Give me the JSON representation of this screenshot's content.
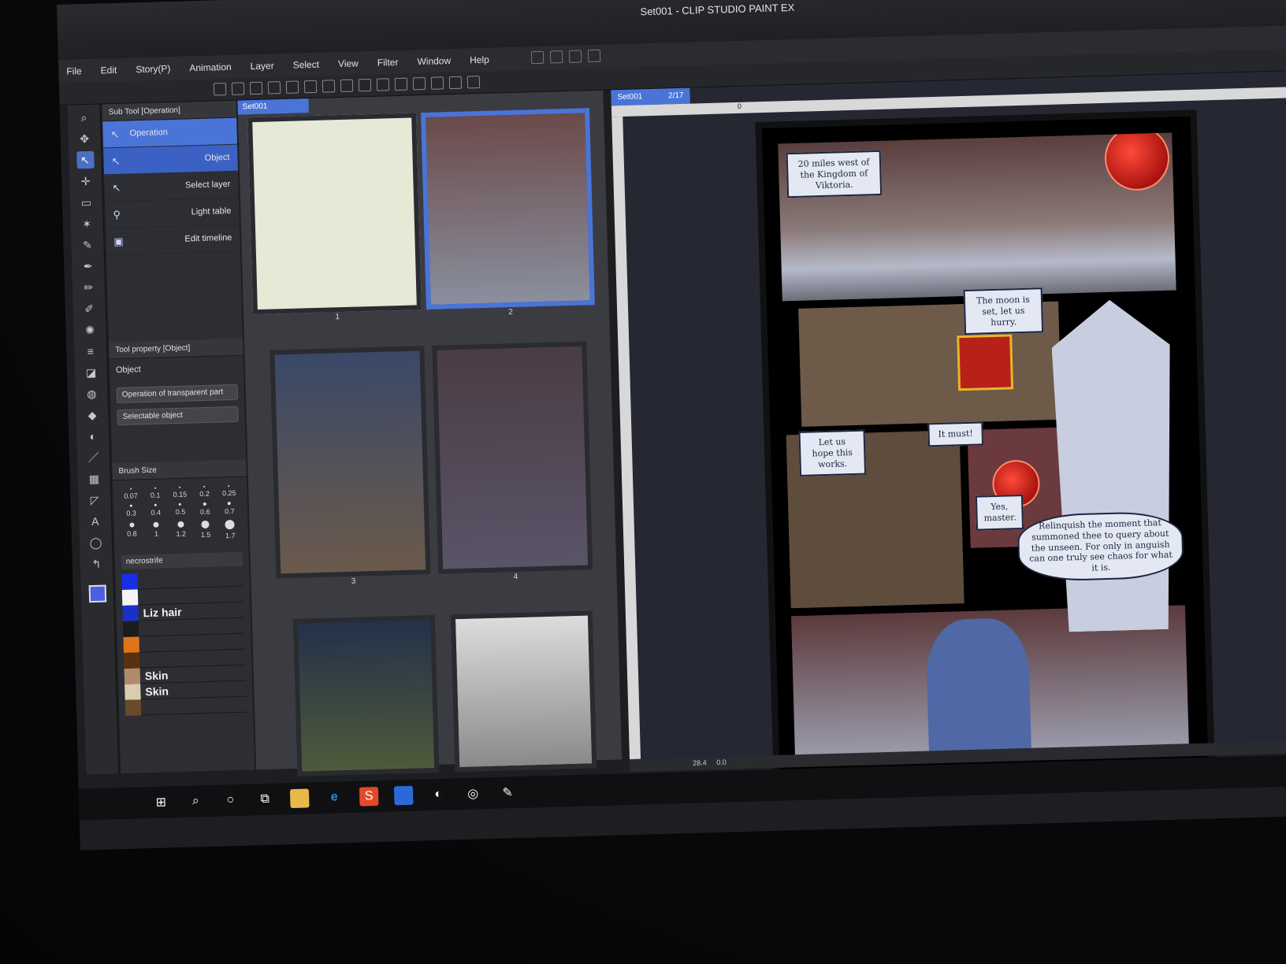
{
  "window": {
    "title": "Set001 - CLIP STUDIO PAINT EX"
  },
  "menu": [
    "File",
    "Edit",
    "Story(P)",
    "Animation",
    "Layer",
    "Select",
    "View",
    "Filter",
    "Window",
    "Help"
  ],
  "subtool_panel": {
    "header": "Sub Tool [Operation]",
    "group": "Operation",
    "items": [
      "Object",
      "Select layer",
      "Light table",
      "Edit timeline"
    ]
  },
  "tool_property": {
    "header": "Tool property [Object]",
    "label": "Object",
    "dropdowns": [
      "Operation of transparent part",
      "Selectable object"
    ]
  },
  "brush_size": {
    "header": "Brush Size",
    "sizes": [
      "0.07",
      "0.1",
      "0.15",
      "0.2",
      "0.25",
      "0.3",
      "0.4",
      "0.5",
      "0.6",
      "0.7",
      "0.8",
      "1",
      "1.2",
      "1.5",
      "1.7"
    ]
  },
  "palette": {
    "name": "necrostrife",
    "swatches": [
      {
        "color": "#1a2ee6",
        "label": ""
      },
      {
        "color": "#f4f4f4",
        "label": ""
      },
      {
        "color": "#1832c8",
        "label": "Liz hair"
      },
      {
        "color": "#1c1c1c",
        "label": ""
      },
      {
        "color": "#e07418",
        "label": ""
      },
      {
        "color": "#5a3010",
        "label": ""
      },
      {
        "color": "#b08a6a",
        "label": "Skin"
      },
      {
        "color": "#d9ccb0",
        "label": "Skin"
      },
      {
        "color": "#6a4a2a",
        "label": ""
      }
    ]
  },
  "pages_panel": {
    "tab": "Set001",
    "pages": [
      "1",
      "2",
      "3",
      "4"
    ]
  },
  "canvas": {
    "tab_name": "Set001",
    "tab_page": "2/17",
    "ruler_zero": "0",
    "zoom": "28.4",
    "angle": "0.0"
  },
  "comic": {
    "caption1": "20 miles west of the Kingdom of Viktoria.",
    "bubble_moon": "The moon is set, let us hurry.",
    "bubble_must": "It must!",
    "bubble_hope": "Let us hope this works.",
    "bubble_yes": "Yes, master.",
    "bubble_long": "Relinquish the moment that summoned thee to query about the unseen. For only in anguish can one truly see chaos for what it is."
  },
  "taskbar": [
    "windows-icon",
    "search-icon",
    "cortana-icon",
    "task-view-icon",
    "file-explorer-icon",
    "edge-icon",
    "sketchbook-icon",
    "store-icon",
    "paint-icon",
    "clip-studio-icon",
    "clip-studio-paint-icon"
  ]
}
